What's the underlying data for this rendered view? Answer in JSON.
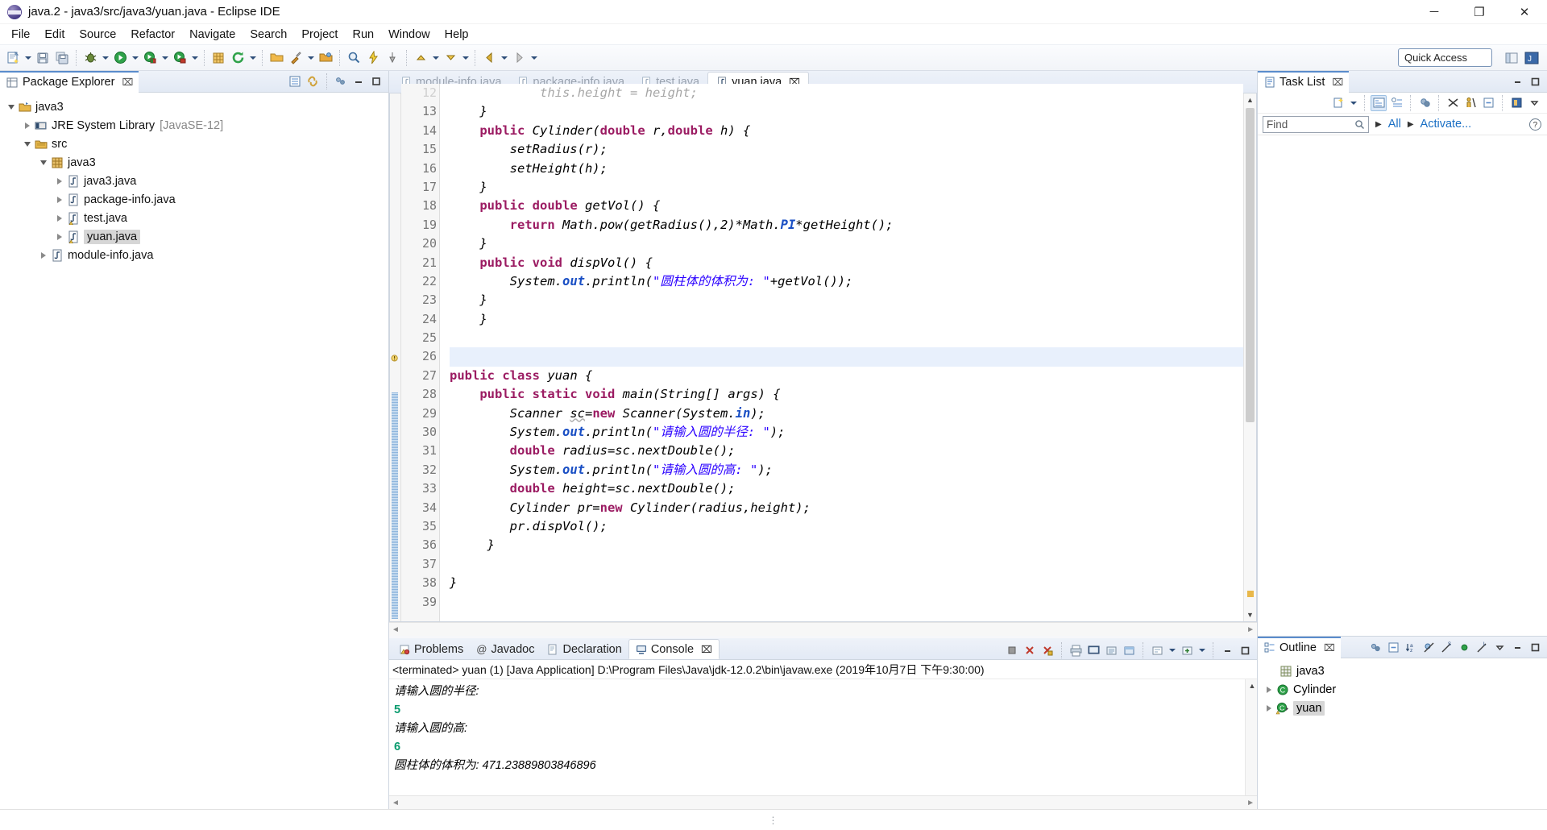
{
  "window": {
    "title": "java.2 - java3/src/java3/yuan.java - Eclipse IDE",
    "minimize": "─",
    "maximize": "❐",
    "close": "✕"
  },
  "menu": [
    "File",
    "Edit",
    "Source",
    "Refactor",
    "Navigate",
    "Search",
    "Project",
    "Run",
    "Window",
    "Help"
  ],
  "toolbar": {
    "quick_access": "Quick Access",
    "icons": [
      "new-wizard-icon",
      "save-icon",
      "save-all-icon",
      "debug-icon",
      "run-icon",
      "coverage-icon",
      "run-last-icon",
      "new-java-package-icon",
      "refresh-icon",
      "open-type-icon",
      "search-icon",
      "external-tools-icon",
      "previous-annotation-icon",
      "next-annotation-icon",
      "back-icon",
      "forward-icon"
    ]
  },
  "package_explorer": {
    "title": "Package Explorer",
    "close": "⌧",
    "tree": [
      {
        "label": "java3",
        "suffix": "",
        "indent": 0,
        "twisty": "down",
        "icon": "java-project-icon",
        "selected": false
      },
      {
        "label": "JRE System Library",
        "suffix": "[JavaSE-12]",
        "indent": 1,
        "twisty": "right",
        "icon": "library-icon",
        "selected": false
      },
      {
        "label": "src",
        "suffix": "",
        "indent": 1,
        "twisty": "down",
        "icon": "source-folder-icon",
        "selected": false
      },
      {
        "label": "java3",
        "suffix": "",
        "indent": 2,
        "twisty": "down",
        "icon": "package-icon",
        "selected": false
      },
      {
        "label": "java3.java",
        "suffix": "",
        "indent": 3,
        "twisty": "right",
        "icon": "java-file-icon",
        "selected": false
      },
      {
        "label": "package-info.java",
        "suffix": "",
        "indent": 3,
        "twisty": "right",
        "icon": "java-file-icon",
        "selected": false
      },
      {
        "label": "test.java",
        "suffix": "",
        "indent": 3,
        "twisty": "right",
        "icon": "java-file-warning-icon",
        "selected": false
      },
      {
        "label": "yuan.java",
        "suffix": "",
        "indent": 3,
        "twisty": "right",
        "icon": "java-file-warning-icon",
        "selected": true
      },
      {
        "label": "module-info.java",
        "suffix": "",
        "indent": 2,
        "twisty": "right",
        "icon": "java-file-icon",
        "selected": false
      }
    ]
  },
  "editor": {
    "tabs": [
      {
        "label": "module-info.java",
        "active": false,
        "icon": "java-file-icon"
      },
      {
        "label": "package-info.java",
        "active": false,
        "icon": "java-file-icon"
      },
      {
        "label": "test.java",
        "active": false,
        "icon": "java-file-warning-icon"
      },
      {
        "label": "yuan.java",
        "active": true,
        "icon": "java-file-warning-icon",
        "close": "⌧"
      }
    ],
    "first_visible_line": 12,
    "lines": [
      {
        "n": 12,
        "partial": true,
        "fold": false,
        "marker": "",
        "highlight": false,
        "tokens": [
          {
            "t": "            this.height = height;",
            "c": "plain"
          }
        ]
      },
      {
        "n": 13,
        "fold": false,
        "marker": "",
        "highlight": false,
        "tokens": [
          {
            "t": "    }",
            "c": "plain"
          }
        ]
      },
      {
        "n": 14,
        "fold": true,
        "marker": "",
        "highlight": false,
        "tokens": [
          {
            "t": "    ",
            "c": "plain"
          },
          {
            "t": "public",
            "c": "kw"
          },
          {
            "t": " Cylinder(",
            "c": "plain"
          },
          {
            "t": "double",
            "c": "kw"
          },
          {
            "t": " r,",
            "c": "plain"
          },
          {
            "t": "double",
            "c": "kw"
          },
          {
            "t": " h) {",
            "c": "plain"
          }
        ]
      },
      {
        "n": 15,
        "fold": false,
        "marker": "",
        "highlight": false,
        "tokens": [
          {
            "t": "        setRadius(r);",
            "c": "plain"
          }
        ]
      },
      {
        "n": 16,
        "fold": false,
        "marker": "",
        "highlight": false,
        "tokens": [
          {
            "t": "        setHeight(h);",
            "c": "plain"
          }
        ]
      },
      {
        "n": 17,
        "fold": false,
        "marker": "",
        "highlight": false,
        "tokens": [
          {
            "t": "    }",
            "c": "plain"
          }
        ]
      },
      {
        "n": 18,
        "fold": true,
        "marker": "",
        "highlight": false,
        "tokens": [
          {
            "t": "    ",
            "c": "plain"
          },
          {
            "t": "public",
            "c": "kw"
          },
          {
            "t": " ",
            "c": "plain"
          },
          {
            "t": "double",
            "c": "kw"
          },
          {
            "t": " getVol() {",
            "c": "plain"
          }
        ]
      },
      {
        "n": 19,
        "fold": false,
        "marker": "",
        "highlight": false,
        "tokens": [
          {
            "t": "        ",
            "c": "plain"
          },
          {
            "t": "return",
            "c": "kw"
          },
          {
            "t": " Math.pow(getRadius(),2)*Math.",
            "c": "plain"
          },
          {
            "t": "PI",
            "c": "fld"
          },
          {
            "t": "*getHeight();",
            "c": "plain"
          }
        ]
      },
      {
        "n": 20,
        "fold": false,
        "marker": "",
        "highlight": false,
        "tokens": [
          {
            "t": "    }",
            "c": "plain"
          }
        ]
      },
      {
        "n": 21,
        "fold": true,
        "marker": "",
        "highlight": false,
        "tokens": [
          {
            "t": "    ",
            "c": "plain"
          },
          {
            "t": "public",
            "c": "kw"
          },
          {
            "t": " ",
            "c": "plain"
          },
          {
            "t": "void",
            "c": "kw"
          },
          {
            "t": " dispVol() {",
            "c": "plain"
          }
        ]
      },
      {
        "n": 22,
        "fold": false,
        "marker": "",
        "highlight": false,
        "tokens": [
          {
            "t": "        System.",
            "c": "plain"
          },
          {
            "t": "out",
            "c": "fld"
          },
          {
            "t": ".println(",
            "c": "plain"
          },
          {
            "t": "\"圆柱体的体积为: \"",
            "c": "str"
          },
          {
            "t": "+getVol());",
            "c": "plain"
          }
        ]
      },
      {
        "n": 23,
        "fold": false,
        "marker": "",
        "highlight": false,
        "tokens": [
          {
            "t": "    }",
            "c": "plain"
          }
        ]
      },
      {
        "n": 24,
        "fold": false,
        "marker": "",
        "highlight": false,
        "tokens": [
          {
            "t": "    }",
            "c": "plain"
          }
        ]
      },
      {
        "n": 25,
        "fold": false,
        "marker": "",
        "highlight": false,
        "tokens": [
          {
            "t": "",
            "c": "plain"
          }
        ]
      },
      {
        "n": 26,
        "fold": false,
        "marker": "",
        "highlight": true,
        "tokens": [
          {
            "t": "",
            "c": "plain"
          }
        ]
      },
      {
        "n": 27,
        "fold": false,
        "marker": "changed",
        "highlight": false,
        "tokens": [
          {
            "t": "",
            "c": "plain"
          },
          {
            "t": "public",
            "c": "kw"
          },
          {
            "t": " ",
            "c": "plain"
          },
          {
            "t": "class",
            "c": "kw"
          },
          {
            "t": " yuan {",
            "c": "plain"
          }
        ]
      },
      {
        "n": 28,
        "fold": true,
        "marker": "changed",
        "highlight": false,
        "tokens": [
          {
            "t": "    ",
            "c": "plain"
          },
          {
            "t": "public",
            "c": "kw"
          },
          {
            "t": " ",
            "c": "plain"
          },
          {
            "t": "static",
            "c": "kw"
          },
          {
            "t": " ",
            "c": "plain"
          },
          {
            "t": "void",
            "c": "kw"
          },
          {
            "t": " main(String[] args) {",
            "c": "plain"
          }
        ]
      },
      {
        "n": 29,
        "fold": false,
        "marker": "warning",
        "highlight": false,
        "tokens": [
          {
            "t": "        Scanner ",
            "c": "plain"
          },
          {
            "t": "sc",
            "c": "und"
          },
          {
            "t": "=",
            "c": "plain"
          },
          {
            "t": "new",
            "c": "kw"
          },
          {
            "t": " Scanner(System.",
            "c": "plain"
          },
          {
            "t": "in",
            "c": "fld"
          },
          {
            "t": ");",
            "c": "plain"
          }
        ]
      },
      {
        "n": 30,
        "fold": false,
        "marker": "changed",
        "highlight": false,
        "tokens": [
          {
            "t": "        System.",
            "c": "plain"
          },
          {
            "t": "out",
            "c": "fld"
          },
          {
            "t": ".println(",
            "c": "plain"
          },
          {
            "t": "\"请输入圆的半径: \"",
            "c": "str"
          },
          {
            "t": ");",
            "c": "plain"
          }
        ]
      },
      {
        "n": 31,
        "fold": false,
        "marker": "changed",
        "highlight": false,
        "tokens": [
          {
            "t": "        ",
            "c": "plain"
          },
          {
            "t": "double",
            "c": "kw"
          },
          {
            "t": " radius=sc.nextDouble();",
            "c": "plain"
          }
        ]
      },
      {
        "n": 32,
        "fold": false,
        "marker": "changed",
        "highlight": false,
        "tokens": [
          {
            "t": "        System.",
            "c": "plain"
          },
          {
            "t": "out",
            "c": "fld"
          },
          {
            "t": ".println(",
            "c": "plain"
          },
          {
            "t": "\"请输入圆的高: \"",
            "c": "str"
          },
          {
            "t": ");",
            "c": "plain"
          }
        ]
      },
      {
        "n": 33,
        "fold": false,
        "marker": "changed",
        "highlight": false,
        "tokens": [
          {
            "t": "        ",
            "c": "plain"
          },
          {
            "t": "double",
            "c": "kw"
          },
          {
            "t": " height=sc.nextDouble();",
            "c": "plain"
          }
        ]
      },
      {
        "n": 34,
        "fold": false,
        "marker": "changed",
        "highlight": false,
        "tokens": [
          {
            "t": "        Cylinder pr=",
            "c": "plain"
          },
          {
            "t": "new",
            "c": "kw"
          },
          {
            "t": " Cylinder(radius,height);",
            "c": "plain"
          }
        ]
      },
      {
        "n": 35,
        "fold": false,
        "marker": "changed",
        "highlight": false,
        "tokens": [
          {
            "t": "        pr.dispVol();",
            "c": "plain"
          }
        ]
      },
      {
        "n": 36,
        "fold": false,
        "marker": "changed",
        "highlight": false,
        "tokens": [
          {
            "t": "     }",
            "c": "plain"
          }
        ]
      },
      {
        "n": 37,
        "fold": false,
        "marker": "changed",
        "highlight": false,
        "tokens": [
          {
            "t": "",
            "c": "plain"
          }
        ]
      },
      {
        "n": 38,
        "fold": false,
        "marker": "changed",
        "highlight": false,
        "tokens": [
          {
            "t": "}",
            "c": "plain"
          }
        ]
      },
      {
        "n": 39,
        "fold": false,
        "marker": "",
        "highlight": false,
        "tokens": [
          {
            "t": "",
            "c": "plain"
          }
        ]
      }
    ]
  },
  "bottom_panel": {
    "tabs": [
      {
        "label": "Problems",
        "active": false,
        "icon": "problems-icon"
      },
      {
        "label": "Javadoc",
        "active": false,
        "icon": "javadoc-icon"
      },
      {
        "label": "Declaration",
        "active": false,
        "icon": "declaration-icon"
      },
      {
        "label": "Console",
        "active": true,
        "icon": "console-icon",
        "close": "⌧"
      }
    ],
    "console_header": "<terminated> yuan (1) [Java Application] D:\\Program Files\\Java\\jdk-12.0.2\\bin\\javaw.exe (2019年10月7日 下午9:30:00)",
    "console_lines": [
      {
        "text": "请输入圆的半径:",
        "kind": "out"
      },
      {
        "text": "5",
        "kind": "in"
      },
      {
        "text": "请输入圆的高:",
        "kind": "out"
      },
      {
        "text": "6",
        "kind": "in"
      },
      {
        "text": "圆柱体的体积为: 471.23889803846896",
        "kind": "out"
      }
    ]
  },
  "task_list": {
    "title": "Task List",
    "close": "⌧",
    "find_placeholder": "Find",
    "filter_all": "All",
    "activate": "Activate...",
    "help": "?"
  },
  "outline": {
    "title": "Outline",
    "close": "⌧",
    "items": [
      {
        "label": "java3",
        "icon": "package-icon",
        "twisty": "",
        "indent": 1,
        "selected": false
      },
      {
        "label": "Cylinder",
        "icon": "class-icon",
        "twisty": "right",
        "indent": 0,
        "selected": false
      },
      {
        "label": "yuan",
        "icon": "class-warning-icon",
        "twisty": "right",
        "indent": 0,
        "selected": true
      }
    ]
  },
  "colors": {
    "keyword": "#9b1b62",
    "string": "#2a00ff",
    "field": "#1a4fc4",
    "console_input": "#0a9b6e",
    "selection": "#e8f0fc",
    "tab_accent": "#5a8ccc"
  }
}
